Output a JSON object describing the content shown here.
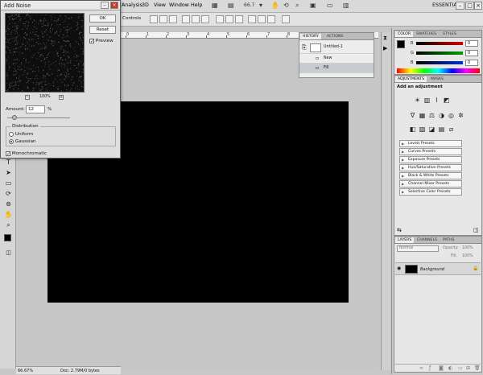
{
  "menubar": {
    "items": [
      "Analysis",
      "3D",
      "View",
      "Window",
      "Help"
    ],
    "zoom_label": "66.7",
    "workspace": "ESSENTIALS"
  },
  "options_bar": {
    "controls_label": "Controls"
  },
  "document": {
    "zoom": "66.67%",
    "doc_info": "Doc: 2.79M/0 bytes",
    "ruler_marks": [
      "0",
      "1",
      "2",
      "3",
      "4",
      "5",
      "6",
      "7",
      "8",
      "9",
      "10",
      "11",
      "12"
    ]
  },
  "history": {
    "tabs": [
      "HISTORY",
      "ACTIONS"
    ],
    "snapshot": "Untitled-1",
    "steps": [
      "New",
      "Fill"
    ]
  },
  "color_panel": {
    "tabs": [
      "COLOR",
      "SWATCHES",
      "STYLES"
    ],
    "channels": [
      {
        "label": "R",
        "value": "0"
      },
      {
        "label": "G",
        "value": "0"
      },
      {
        "label": "B",
        "value": "0"
      }
    ]
  },
  "adjustments": {
    "tabs": [
      "ADJUSTMENTS",
      "MASKS"
    ],
    "heading": "Add an adjustment",
    "presets": [
      "Levels Presets",
      "Curves Presets",
      "Exposure Presets",
      "Hue/Saturation Presets",
      "Black & White Presets",
      "Channel Mixer Presets",
      "Selective Color Presets"
    ]
  },
  "layers": {
    "tabs": [
      "LAYERS",
      "CHANNELS",
      "PATHS"
    ],
    "blend_mode": "Normal",
    "opacity_label": "Opacity:",
    "opacity": "100%",
    "fill_label": "Fill:",
    "fill": "100%",
    "layer_name": "Background"
  },
  "dialog": {
    "title": "Add Noise",
    "ok_label": "OK",
    "reset_label": "Reset",
    "preview_label": "Preview",
    "preview_zoom": "100%",
    "amount_label": "Amount:",
    "amount_value": "12",
    "amount_unit": "%",
    "amount_level": 0.12,
    "distribution_label": "Distribution",
    "uniform_label": "Uniform",
    "gaussian_label": "Gaussian",
    "mono_label": "Monochromatic"
  },
  "colors": {
    "canvas": "#000000",
    "accent_red": "#d60000",
    "accent_green": "#00a000",
    "accent_blue": "#0030d0"
  }
}
